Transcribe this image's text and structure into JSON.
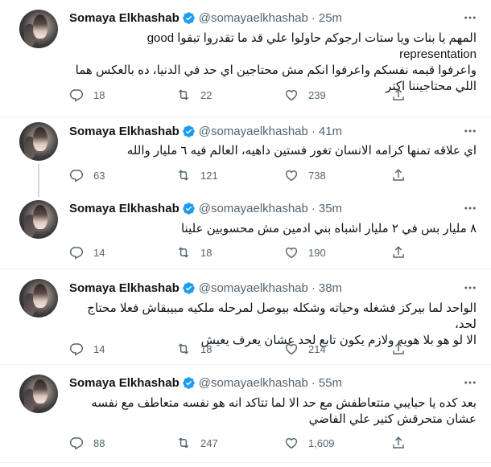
{
  "author": {
    "name": "Somaya Elkhashab",
    "handle": "@somayaelkhashab",
    "separator": "·"
  },
  "tweets": [
    {
      "time": "25m",
      "lines": [
        "المهم يا بنات ويا ستات ارجوكم حاولوا علي قد ما تقدروا تبقوا good representation",
        "واعرفوا قيمه نفسكم واعرفوا انكم مش محتاجين اي حد في الدنيا، ده بالعكس هما",
        "اللي محتاجيننا اكتر"
      ],
      "replies": "18",
      "retweets": "22",
      "likes": "239"
    },
    {
      "time": "41m",
      "lines": [
        "اي علاقه تمنها كرامه الانسان تغور فستين داهيه، العالم فيه ٦ مليار والله"
      ],
      "replies": "63",
      "retweets": "121",
      "likes": "738"
    },
    {
      "time": "35m",
      "lines": [
        "٨ مليار بس في ٢ مليار اشباه بني ادمين مش محسوبين علينا"
      ],
      "replies": "14",
      "retweets": "18",
      "likes": "190"
    },
    {
      "time": "38m",
      "lines": [
        "الواحد لما بيركز فشغله وحياته وشكله بيوصل لمرحله ملكيه مبيبقاش فعلا محتاج لحد،",
        "الا لو هو بلا هويه ولازم يكون تابع لحد عشان يعرف يعيش"
      ],
      "replies": "14",
      "retweets": "18",
      "likes": "214"
    },
    {
      "time": "55m",
      "lines": [
        "بعد كده يا حبايبي متتعاطفش مع حد الا لما تتاكد انه هو نفسه متعاطف مع نفسه",
        "عشان متحرقش كتير علي الفاضي"
      ],
      "replies": "88",
      "retweets": "247",
      "likes": "1,609"
    }
  ],
  "colors": {
    "verified": "#1d9bf0",
    "text": "#0f1419",
    "secondary": "#536471",
    "divider": "#eff3f4",
    "thread_line": "#cfd9de"
  },
  "icons": [
    "more-icon",
    "verified-badge-icon",
    "reply-icon",
    "retweet-icon",
    "like-icon",
    "share-icon"
  ]
}
